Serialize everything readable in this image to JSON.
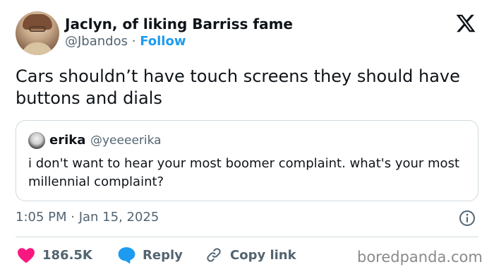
{
  "author": {
    "display_name": "Jaclyn, of liking Barriss fame",
    "handle": "@Jbandos",
    "separator": "·",
    "follow_label": "Follow",
    "avatar_icon": "profile-photo"
  },
  "platform_logo": "x-logo-icon",
  "tweet": {
    "text": "Cars shouldn’t have touch screens they should have buttons and dials",
    "timestamp": "1:05 PM · Jan 15, 2025"
  },
  "quoted_tweet": {
    "name": "erika",
    "handle": "@yeeeerika",
    "text": "i don't want to hear your most boomer complaint. what's your most millennial complaint?"
  },
  "actions": {
    "likes": "186.5K",
    "reply_label": "Reply",
    "copy_link_label": "Copy link"
  },
  "colors": {
    "like": "#f91880",
    "reply": "#1d9bf0",
    "link_blue": "#1d9bf0",
    "muted": "#536471"
  },
  "watermark": "boredpanda.com"
}
